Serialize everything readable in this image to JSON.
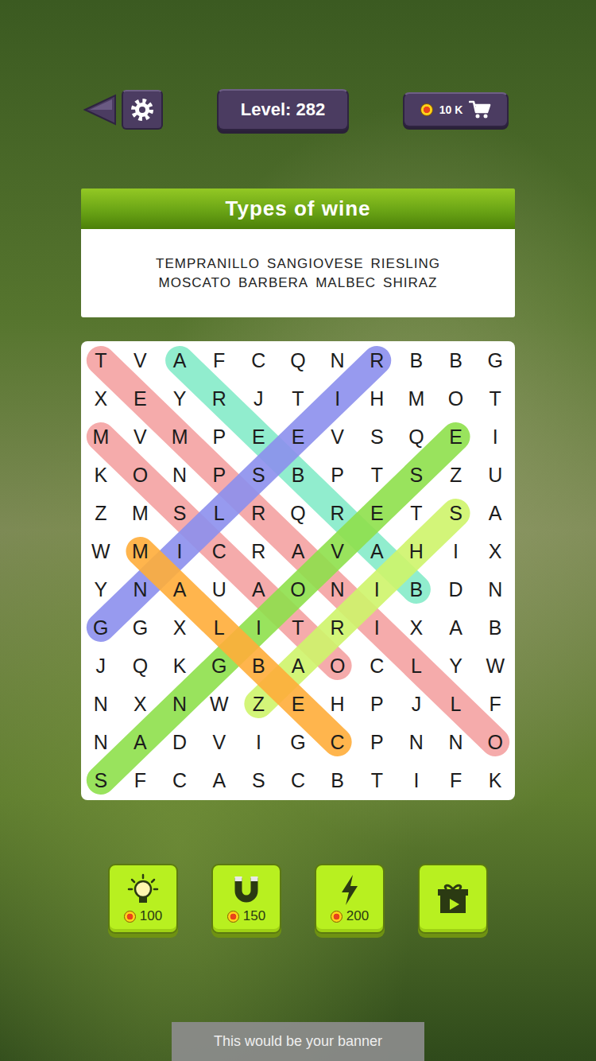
{
  "header": {
    "level": "Level: 282",
    "coins": "10 K"
  },
  "category": {
    "title": "Types of wine"
  },
  "word_rows": [
    [
      "TEMPRANILLO",
      "SANGIOVESE",
      "RIESLING"
    ],
    [
      "MOSCATO",
      "BARBERA",
      "MALBEC",
      "SHIRAZ"
    ]
  ],
  "grid": {
    "rows": [
      "TVAFCQNRBBG",
      "XEYRJTIHMOT",
      "MVMPEEVSQEI",
      "KONPSBPTSZU",
      "ZMSLRQRETSA",
      "WMICRAVAHIX",
      "YNAUAONIBDN",
      "GGXLITRIXAB",
      "JQKGBAOCLYW",
      "NXNWZEHPJLF",
      "NADVIGCPNNO",
      "SFCASCBTIFK"
    ]
  },
  "found_lines": [
    {
      "word": "TEMPRANILLO",
      "from": [
        0,
        0
      ],
      "to": [
        10,
        10
      ],
      "color": "#f5a3a3"
    },
    {
      "word": "MOSCATO",
      "from": [
        2,
        0
      ],
      "to": [
        8,
        6
      ],
      "color": "#f5a3a3"
    },
    {
      "word": "BARBERA",
      "from": [
        6,
        8
      ],
      "to": [
        0,
        2
      ],
      "color": "#86ecc9"
    },
    {
      "word": "RIESLING",
      "from": [
        0,
        7
      ],
      "to": [
        7,
        0
      ],
      "color": "#8c90ee"
    },
    {
      "word": "SANGIOVESE",
      "from": [
        11,
        0
      ],
      "to": [
        2,
        9
      ],
      "color": "#8fe04c"
    },
    {
      "word": "SHIRAZ",
      "from": [
        4,
        9
      ],
      "to": [
        9,
        4
      ],
      "color": "#cff56b"
    },
    {
      "word": "MALBEC",
      "from": [
        5,
        1
      ],
      "to": [
        10,
        6
      ],
      "color": "#ffae3a"
    }
  ],
  "boosters": [
    {
      "kind": "hint",
      "price": "100"
    },
    {
      "kind": "magnet",
      "price": "150"
    },
    {
      "kind": "bolt",
      "price": "200"
    },
    {
      "kind": "video"
    }
  ],
  "banner": "This would be your banner"
}
